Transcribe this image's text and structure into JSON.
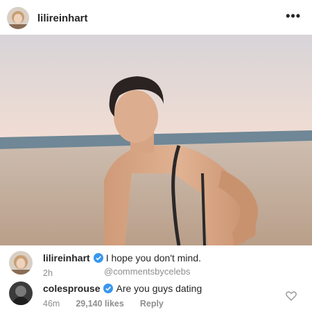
{
  "post": {
    "username": "lilireinhart",
    "more_icon": "more-horizontal-icon"
  },
  "photo": {
    "description_icon": "post-photo",
    "colors": {
      "sky": "#e9dcd8",
      "sea": "#6f8796",
      "sand": "#c9b6a6"
    }
  },
  "comments": [
    {
      "username": "lilireinhart",
      "verified": true,
      "text": "I hope you don't mind.",
      "time": "2h",
      "watermark": "@commentsbycelebs"
    },
    {
      "username": "colesprouse",
      "verified": true,
      "text": "Are you guys dating",
      "time": "46m",
      "likes": "29,140 likes",
      "reply": "Reply"
    }
  ],
  "colors": {
    "verified": "#3897f0",
    "muted": "#8e8e8e",
    "text": "#262626"
  }
}
